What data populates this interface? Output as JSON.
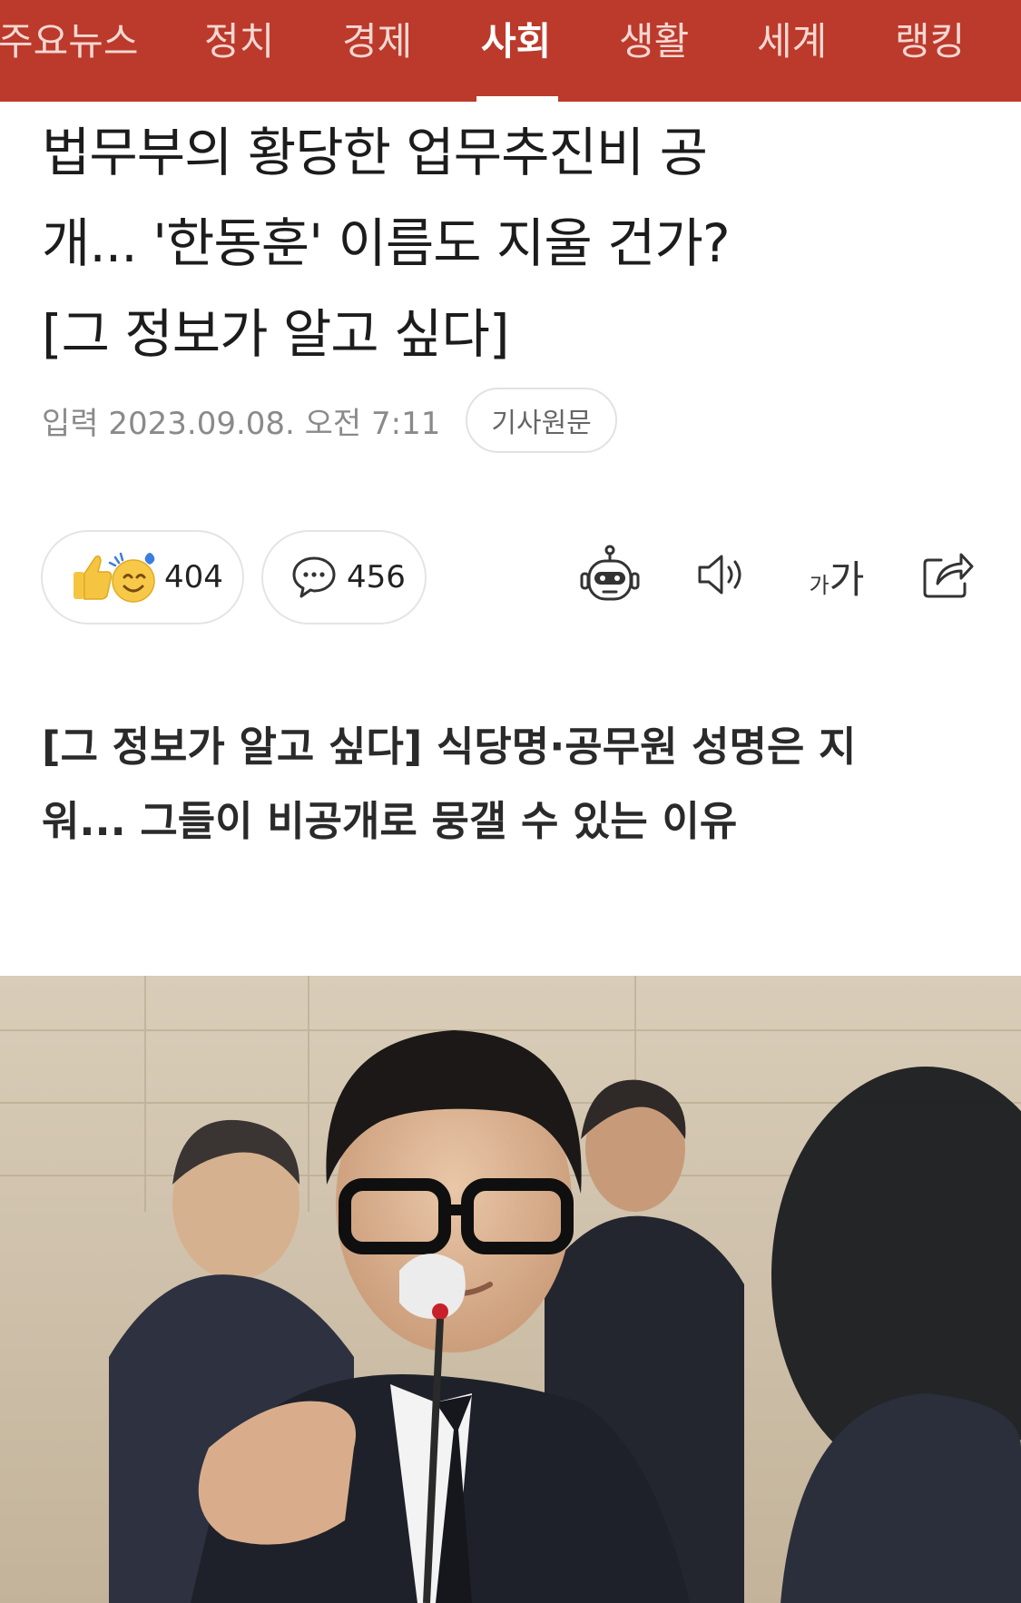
{
  "nav": {
    "tabs": [
      {
        "label": "주요뉴스"
      },
      {
        "label": "정치"
      },
      {
        "label": "경제"
      },
      {
        "label": "사회",
        "active": true
      },
      {
        "label": "생활"
      },
      {
        "label": "세계"
      },
      {
        "label": "랭킹"
      }
    ],
    "accent_color": "#bb3a2b"
  },
  "article": {
    "headline_lines": [
      "법무부의 황당한 업무추진비 공",
      "개... '한동훈' 이름도 지울 건가?",
      "[그 정보가 알고 싶다]"
    ],
    "published": "입력 2023.09.08. 오전 7:11",
    "original_link_label": "기사원문",
    "reactions": {
      "like_count": "404",
      "comment_count": "456"
    },
    "tools": [
      "robot-summary-icon",
      "speaker-icon",
      "font-size-icon",
      "share-icon"
    ],
    "font_size_glyph_small": "가",
    "font_size_glyph_large": "가",
    "subtitle_lines": [
      "[그 정보가 알고 싶다] 식당명·공무원 성명은 지",
      "워... 그들이 비공개로 뭉갤 수 있는 이유"
    ]
  }
}
